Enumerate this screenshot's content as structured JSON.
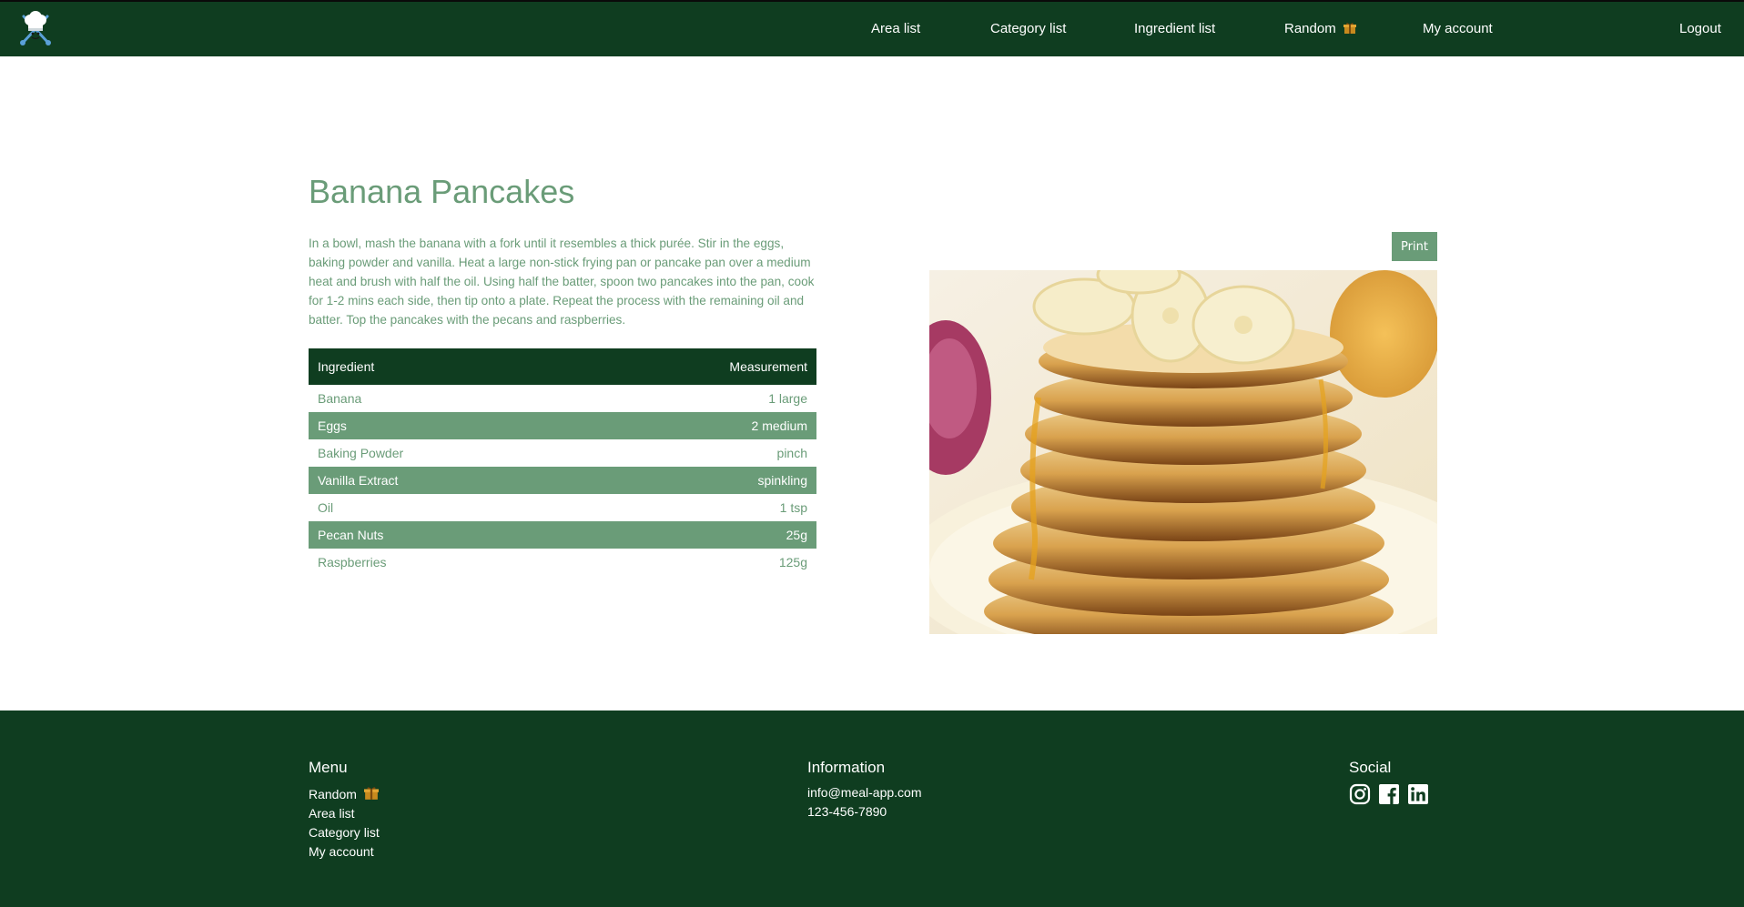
{
  "nav": {
    "logo_icon": "chef-hat-crossed-utensils-icon",
    "links": {
      "area": "Area list",
      "category": "Category list",
      "ingredient": "Ingredient list",
      "random": "Random",
      "account": "My account",
      "logout": "Logout"
    },
    "random_icon": "gift-box-icon"
  },
  "recipe": {
    "title": "Banana Pancakes",
    "description": "In a bowl, mash the banana with a fork until it resembles a thick purée. Stir in the eggs, baking powder and vanilla. Heat a large non-stick frying pan or pancake pan over a medium heat and brush with half the oil. Using half the batter, spoon two pancakes into the pan, cook for 1-2 mins each side, then tip onto a plate. Repeat the process with the remaining oil and batter. Top the pancakes with the pecans and raspberries.",
    "print_label": "Print",
    "image_alt": "stack of banana pancakes with honey"
  },
  "ingredients": {
    "headers": [
      "Ingredient",
      "Measurement"
    ],
    "rows": [
      {
        "name": "Banana",
        "measure": "1 large"
      },
      {
        "name": "Eggs",
        "measure": "2 medium"
      },
      {
        "name": "Baking Powder",
        "measure": "pinch"
      },
      {
        "name": "Vanilla Extract",
        "measure": "spinkling"
      },
      {
        "name": "Oil",
        "measure": "1 tsp"
      },
      {
        "name": "Pecan Nuts",
        "measure": "25g"
      },
      {
        "name": "Raspberries",
        "measure": "125g"
      }
    ]
  },
  "footer": {
    "menu": {
      "heading": "Menu",
      "items": [
        "Random",
        "Area list",
        "Category list",
        "My account"
      ]
    },
    "information": {
      "heading": "Information",
      "email": "info@meal-app.com",
      "phone": "123-456-7890"
    },
    "social": {
      "heading": "Social",
      "icons": [
        "instagram-icon",
        "facebook-icon",
        "linkedin-icon"
      ]
    }
  },
  "colors": {
    "brand_dark": "#0f3d20",
    "accent_green": "#6a9c78",
    "white": "#ffffff"
  }
}
